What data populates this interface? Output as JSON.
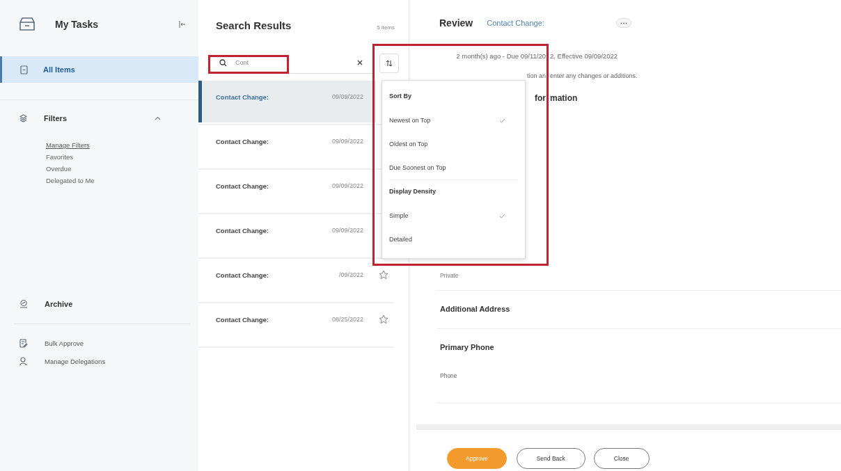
{
  "sidebar": {
    "title": "My Tasks",
    "items": [
      {
        "label": "All Items",
        "selected": true
      }
    ],
    "filters": {
      "label": "Filters",
      "expanded": true,
      "links": [
        {
          "label": "Manage Filters",
          "kind": "link"
        },
        {
          "label": "Favorites",
          "kind": "plain"
        },
        {
          "label": "Overdue",
          "kind": "plain"
        },
        {
          "label": "Delegated to Me",
          "kind": "plain"
        }
      ]
    },
    "archive": "Archive",
    "actions": [
      {
        "label": "Bulk Approve",
        "kind": "approve"
      },
      {
        "label": "Manage Delegations",
        "kind": "person"
      }
    ]
  },
  "results": {
    "title": "Search Results",
    "count": "5 items",
    "search": {
      "value": "Cont"
    },
    "rows": [
      {
        "label": "Contact Change:",
        "date": "09/09/2022",
        "selected": true,
        "star": false
      },
      {
        "label": "Contact Change:",
        "date": "09/09/2022",
        "selected": false,
        "star": false
      },
      {
        "label": "Contact Change:",
        "date": "09/09/2022",
        "selected": false,
        "star": false
      },
      {
        "label": "Contact Change:",
        "date": "09/09/2022",
        "selected": false,
        "star": false
      },
      {
        "label": "Contact Change:",
        "date": "/09/2022",
        "selected": false,
        "star": true
      },
      {
        "label": "Contact Change:",
        "date": "08/25/2022",
        "selected": false,
        "star": true
      }
    ]
  },
  "sort_menu": {
    "groups": [
      {
        "title": "Sort By",
        "options": [
          {
            "label": "Newest on Top",
            "checked": true
          },
          {
            "label": "Oldest on Top",
            "checked": false
          },
          {
            "label": "Due Soonest on Top",
            "checked": false
          }
        ]
      },
      {
        "title": "Display Density",
        "options": [
          {
            "label": "Simple",
            "checked": true
          },
          {
            "label": "Detailed",
            "checked": false
          }
        ]
      }
    ]
  },
  "review": {
    "title": "Review",
    "subject": "Contact Change:",
    "meta": [
      "2 month(s) ago - Due 09/11/20",
      "2, Effective 09/09/2022"
    ],
    "instruction": [
      "tion an",
      "enter any changes or additions."
    ],
    "heading": [
      "for",
      "mation"
    ],
    "visibility_value": "Private",
    "sections": [
      {
        "title": "Additional Address"
      },
      {
        "title": "Primary Phone",
        "field": "Phone"
      }
    ],
    "buttons": [
      {
        "label": "Approve",
        "kind": "primary"
      },
      {
        "label": "Send Back",
        "kind": "secondary"
      },
      {
        "label": "Close",
        "kind": "secondary"
      }
    ]
  }
}
